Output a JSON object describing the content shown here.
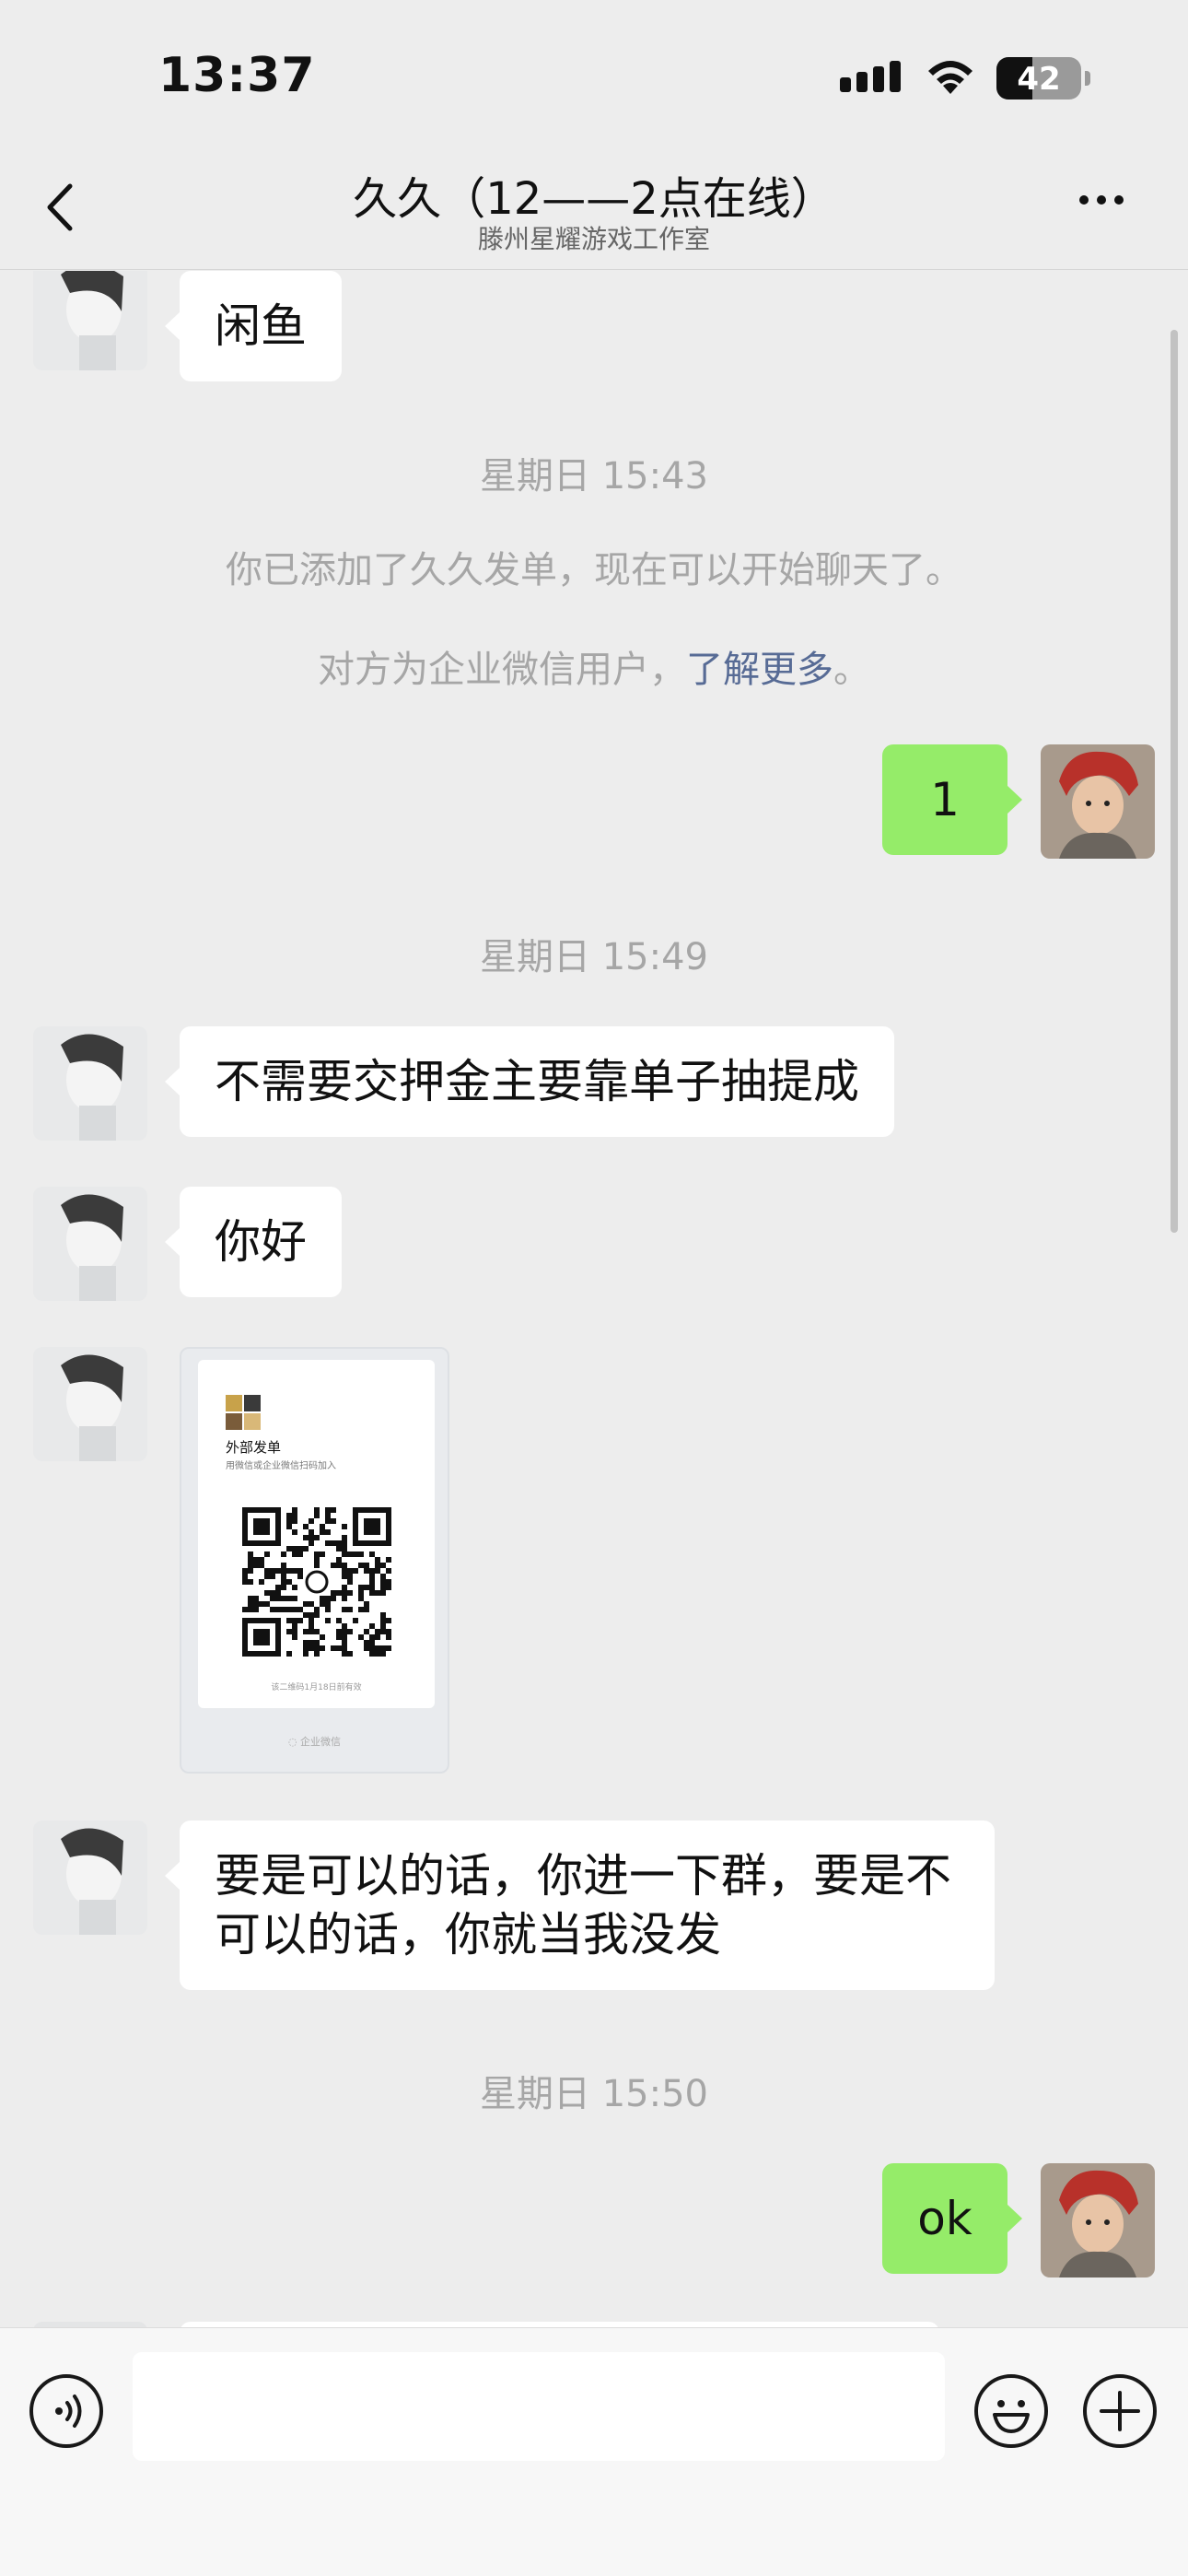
{
  "status_bar": {
    "time": "13:37",
    "battery": "42",
    "battery_level": 0.42
  },
  "nav": {
    "title": "久久（12——2点在线）",
    "subtitle": "滕州星耀游戏工作室",
    "back_icon": "chevron-left-icon",
    "more_icon": "more-dots-icon"
  },
  "messages": {
    "m1": "闲鱼",
    "time1": "星期日 15:43",
    "sys1": "你已添加了久久发单，现在可以开始聊天了。",
    "sys2_prefix": "对方为企业微信用户，",
    "sys2_link": "了解更多",
    "sys2_suffix": "。",
    "m2": "1",
    "time2": "星期日 15:49",
    "m3": "不需要交押金主要靠单子抽提成",
    "m4": "你好",
    "qr": {
      "title": "外部发单",
      "desc": "用微信或企业微信扫码加入",
      "expire": "该二维码1月18日前有效",
      "footer": "企业微信"
    },
    "m5_line1": "要是可以的话，你进一下群，要是不",
    "m5_line2": "可以的话，你就当我没发",
    "time3": "星期日 15:50",
    "m6": "ok"
  },
  "input_bar": {
    "voice_icon": "voice-icon",
    "emoji_icon": "emoji-icon",
    "plus_icon": "plus-icon",
    "input_value": ""
  },
  "colors": {
    "background": "#ededed",
    "sent_bubble": "#95ec69",
    "received_bubble": "#ffffff",
    "link": "#576b95",
    "system_text": "#a6a6a6"
  }
}
